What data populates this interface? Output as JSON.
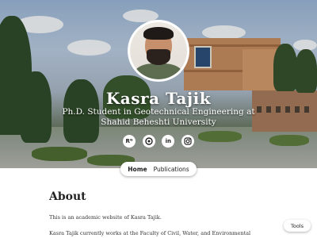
{
  "profile": {
    "name": "Kasra Tajik",
    "subtitle": "Ph.D. Student in Geotechnical Engineering at Shahid Beheshti University"
  },
  "socials": [
    {
      "icon": "researchgate-icon",
      "glyph": "Rᴳ"
    },
    {
      "icon": "orcid-icon",
      "glyph": ""
    },
    {
      "icon": "linkedin-icon",
      "glyph": "in"
    },
    {
      "icon": "instagram-icon",
      "glyph": ""
    }
  ],
  "nav": {
    "home_label": "Home",
    "publications_label": "Publications"
  },
  "about": {
    "title": "About",
    "paragraph_1": "This is an academic website of Kasra Tajik.",
    "paragraph_2": "Kasra Tajik currently works at the Faculty of Civil, Water, and Environmental"
  },
  "tools_label": "Tools"
}
